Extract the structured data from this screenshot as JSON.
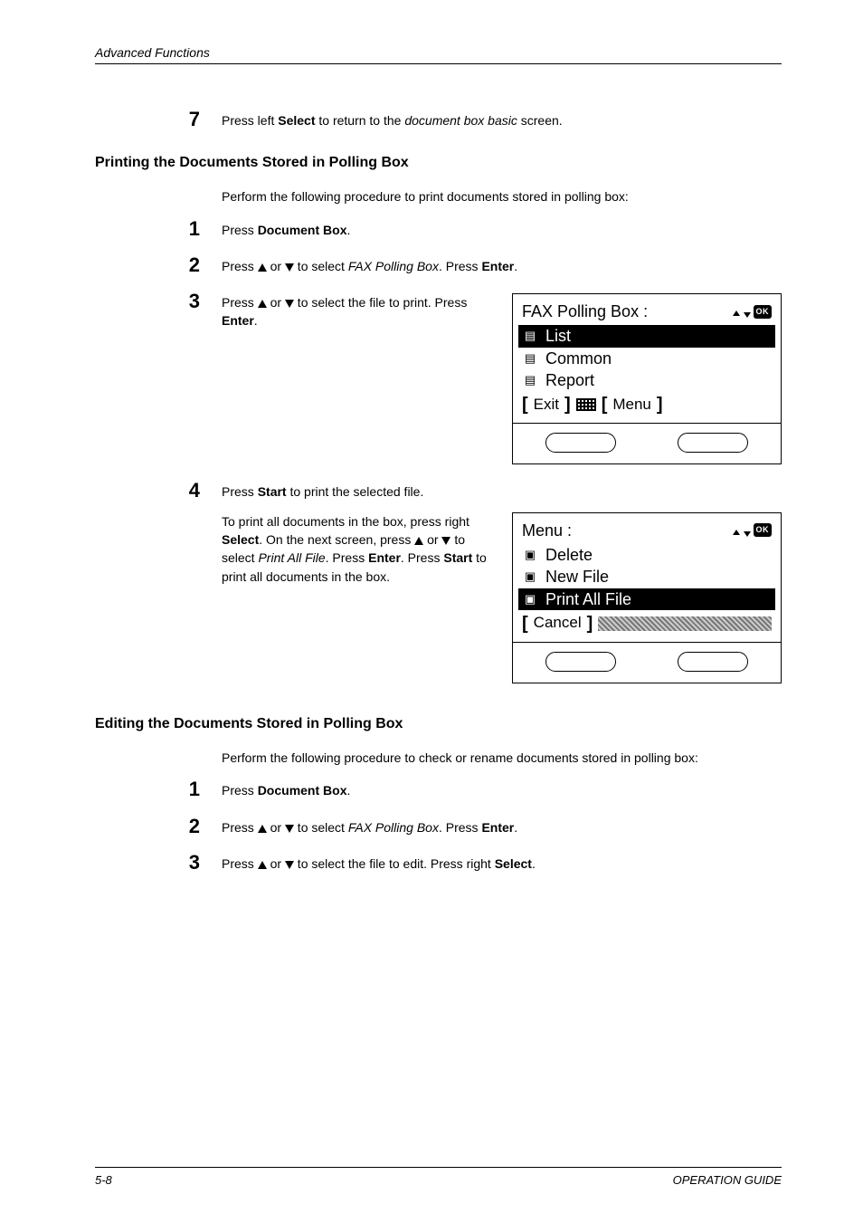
{
  "header": {
    "title": "Advanced Functions"
  },
  "intro_step": {
    "num": "7",
    "prefix": "Press left ",
    "bold": "Select",
    "mid": " to return to the ",
    "italic": "document box basic",
    "suffix": " screen."
  },
  "printing": {
    "heading": "Printing the Documents Stored in Polling Box",
    "intro": "Perform the following procedure to print documents stored in polling box:",
    "s1": {
      "num": "1",
      "prefix": "Press ",
      "bold": "Document Box",
      "suffix": "."
    },
    "s2": {
      "num": "2",
      "a": "Press ",
      "b": " or ",
      "c": " to select ",
      "italic": "FAX Polling Box",
      "d": ". Press ",
      "bold": "Enter",
      "e": "."
    },
    "s3": {
      "num": "3",
      "a": "Press ",
      "b": " or ",
      "c": " to select the file to print. Press ",
      "bold": "Enter",
      "d": "."
    },
    "screen1": {
      "title": "FAX Polling Box :",
      "row1": "List",
      "row2": "Common",
      "row3": "Report",
      "left": "Exit",
      "right": "Menu"
    },
    "s4": {
      "num": "4",
      "line1a": "Press ",
      "line1bold": "Start",
      "line1b": " to print the selected file.",
      "p2a": "To print all documents in the box, press right ",
      "p2b1": "Select",
      "p2c": ". On the next screen, press ",
      "p2d": " or ",
      "p2e": " to select ",
      "p2it": "Print All File",
      "p2f": ". Press ",
      "p2b2": "Enter",
      "p2g": ". Press ",
      "p2b3": "Start",
      "p2h": " to print all documents in the box."
    },
    "screen2": {
      "title": "Menu :",
      "row1": "Delete",
      "row2": "New File",
      "row3": "Print All File",
      "left": "Cancel"
    }
  },
  "editing": {
    "heading": "Editing the Documents Stored in Polling Box",
    "intro": "Perform the following procedure to check or rename documents stored in polling box:",
    "s1": {
      "num": "1",
      "prefix": "Press ",
      "bold": "Document Box",
      "suffix": "."
    },
    "s2": {
      "num": "2",
      "a": "Press ",
      "b": " or ",
      "c": " to select ",
      "italic": "FAX Polling Box",
      "d": ". Press ",
      "bold": "Enter",
      "e": "."
    },
    "s3": {
      "num": "3",
      "a": "Press ",
      "b": " or ",
      "c": " to select the file to edit. Press right ",
      "bold": "Select",
      "d": "."
    }
  },
  "footer": {
    "page": "5-8",
    "guide": "OPERATION GUIDE"
  }
}
